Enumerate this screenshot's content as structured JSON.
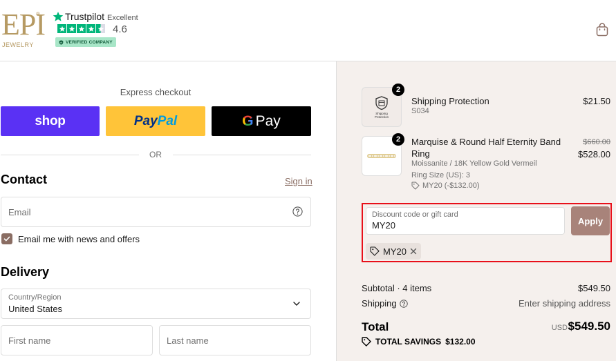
{
  "header": {
    "logo": {
      "main": "EPI",
      "registered": "®",
      "sub": "JEWELRY"
    },
    "trustpilot": {
      "brand": "Trustpilot",
      "rating_word": "Excellent",
      "score": "4.6",
      "stars": 4.6,
      "verified": "VERIFIED COMPANY",
      "color": "#00b67a"
    },
    "cart_icon": "shopping-bag-icon"
  },
  "express": {
    "title": "Express checkout",
    "shop_label": "shop",
    "paypal_pay": "Pay",
    "paypal_pal": "Pal",
    "gpay_label": "Pay",
    "or_text": "OR"
  },
  "contact": {
    "title": "Contact",
    "signin": "Sign in",
    "email_placeholder": "Email",
    "newsletter_label": "Email me with news and offers",
    "newsletter_checked": true
  },
  "delivery": {
    "title": "Delivery",
    "country_label": "Country/Region",
    "country_value": "United States",
    "first_name_placeholder": "First name",
    "last_name_placeholder": "Last name"
  },
  "order": {
    "items": [
      {
        "thumb_text": "Shipping Protection",
        "quantity": "2",
        "name": "Shipping Protection",
        "sku": "S034",
        "price": "$21.50"
      },
      {
        "quantity": "2",
        "name_line1": "Marquise & Round Half Eternity Band",
        "name_line2": "Ring",
        "variant": "Moissanite / 18K Yellow Gold Vermeil",
        "ring_size": "Ring Size (US): 3",
        "discount": "MY20 (-$132.00)",
        "compare_price": "$660.00",
        "price": "$528.00"
      }
    ],
    "discount": {
      "label": "Discount code or gift card",
      "value": "MY20",
      "apply_label": "Apply",
      "applied_code": "MY20"
    },
    "summary": {
      "subtotal_label": "Subtotal · 4 items",
      "subtotal_value": "$549.50",
      "shipping_label": "Shipping",
      "shipping_value": "Enter shipping address",
      "total_label": "Total",
      "currency": "USD",
      "total_value": "$549.50",
      "savings_label": "TOTAL SAVINGS",
      "savings_value": "$132.00"
    }
  },
  "colors": {
    "accent": "#8a6d63",
    "apply_button": "#a8837a",
    "shop_pay": "#5a31f4",
    "paypal": "#ffc439",
    "highlight_border": "#e8101a",
    "sidebar_bg": "#f5f0ed"
  }
}
